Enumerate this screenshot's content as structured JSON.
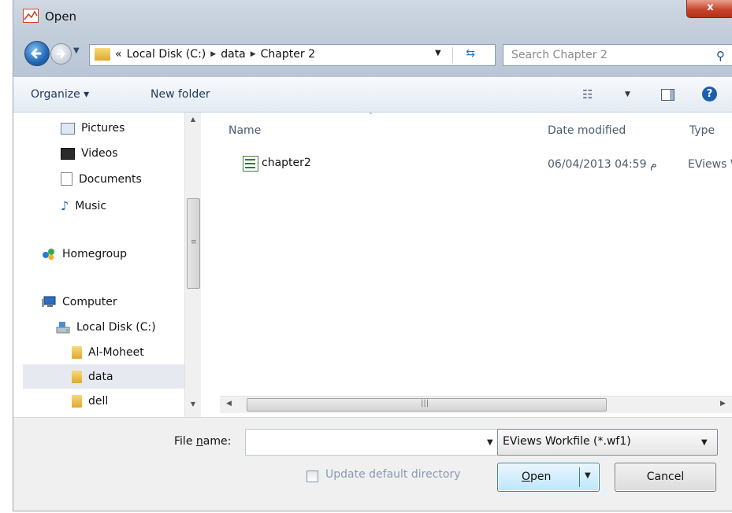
{
  "window": {
    "title": "Open",
    "close_glyph": "x"
  },
  "address": {
    "crumb_prefix": "«",
    "crumbs": [
      "Local Disk (C:)",
      "data",
      "Chapter 2"
    ],
    "sep_glyph": "▶",
    "search_placeholder": "Search Chapter 2"
  },
  "toolbar": {
    "organize": "Organize ▾",
    "new_folder": "New folder"
  },
  "nav": {
    "items": [
      "Pictures",
      "Videos",
      "Documents",
      "Music",
      "Homegroup",
      "Computer",
      "Local Disk (C:)",
      "Al-Moheet",
      "data",
      "dell"
    ],
    "selected": "data"
  },
  "files": {
    "columns": [
      "Name",
      "Date modified",
      "Type"
    ],
    "rows": [
      {
        "name": "chapter2",
        "date": "06/04/2013 04:59 م",
        "type": "EViews W"
      }
    ]
  },
  "footer": {
    "file_name_label_pre": "File ",
    "file_name_label_u": "n",
    "file_name_label_post": "ame:",
    "file_name_value": "",
    "file_type": "EViews Workfile (*.wf1)",
    "update_dir": "Update default directory",
    "open_u": "O",
    "open_rest": "pen",
    "cancel": "Cancel"
  },
  "colors": {
    "accent": "#1f66b5",
    "selection": "#e6eaf0",
    "titlebar": "#c2cdda"
  },
  "icons": [
    "app-icon",
    "back-arrow-icon",
    "forward-arrow-icon",
    "folder-icon",
    "refresh-icon",
    "search-icon",
    "views-icon",
    "preview-pane-icon",
    "help-icon",
    "pictures-icon",
    "videos-icon",
    "documents-icon",
    "music-icon",
    "homegroup-icon",
    "computer-icon",
    "drive-icon",
    "workfile-icon"
  ]
}
